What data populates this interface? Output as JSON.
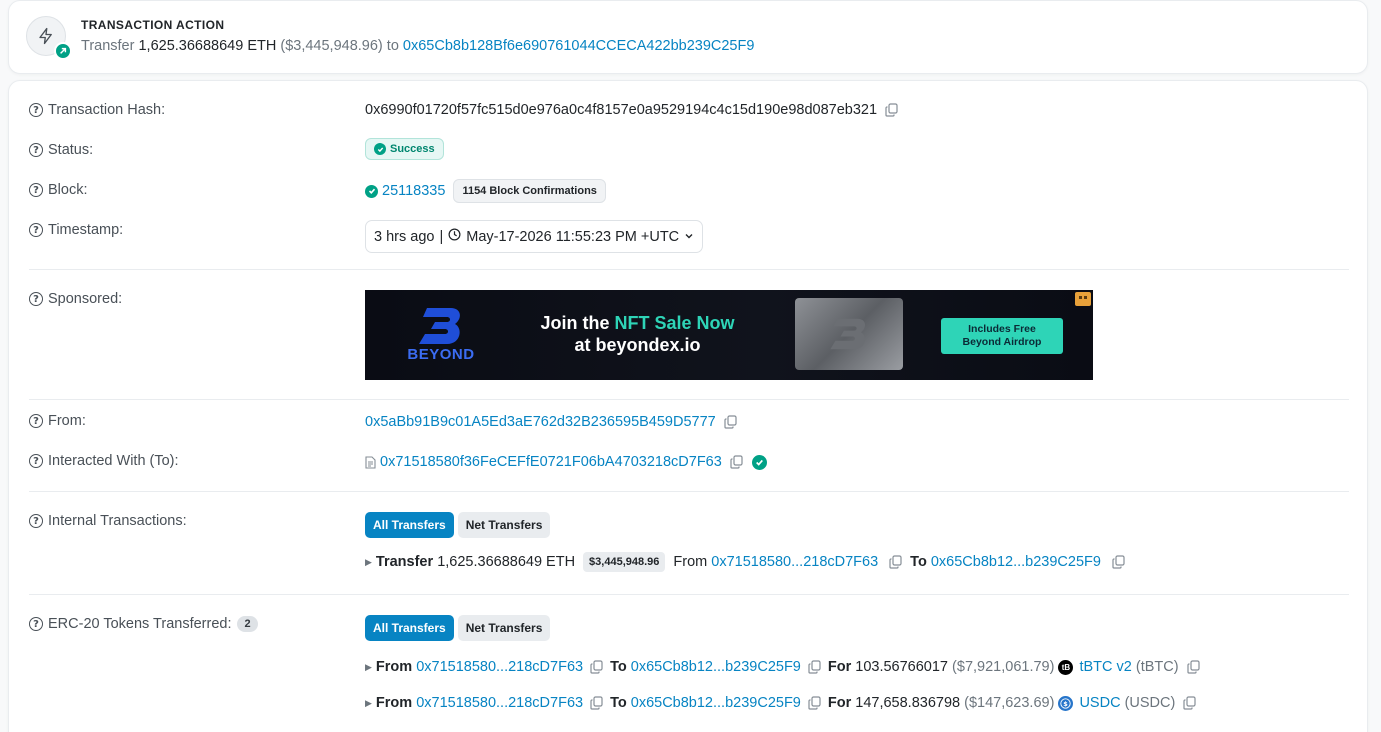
{
  "action": {
    "title": "TRANSACTION ACTION",
    "verb": "Transfer",
    "amount": "1,625.36688649 ETH",
    "usd": "($3,445,948.96)",
    "to_word": "to",
    "to_address": "0x65Cb8b128Bf6e690761044CCECA422bb239C25F9"
  },
  "details": {
    "tx_hash": {
      "label": "Transaction Hash:",
      "value": "0x6990f01720f57fc515d0e976a0c4f8157e0a9529194c4c15d190e98d087eb321"
    },
    "status": {
      "label": "Status:",
      "value": "Success"
    },
    "block": {
      "label": "Block:",
      "number": "25118335",
      "confirmations": "1154 Block Confirmations"
    },
    "timestamp": {
      "label": "Timestamp:",
      "ago": "3 hrs ago",
      "sep": "|",
      "datetime": "May-17-2026 11:55:23 PM +UTC"
    },
    "sponsored": {
      "label": "Sponsored:",
      "brand": "BEYOND",
      "headline_pre": "Join the ",
      "headline_hl": "NFT Sale Now",
      "headline_post": "at beyondex.io",
      "cta": "Includes Free Beyond Airdrop"
    },
    "from": {
      "label": "From:",
      "value": "0x5aBb91B9c01A5Ed3aE762d32B236595B459D5777"
    },
    "interacted": {
      "label": "Interacted With (To):",
      "value": "0x71518580f36FeCEFfE0721F06bA4703218cD7F63"
    },
    "internal": {
      "label": "Internal Transactions:",
      "btn_all": "All Transfers",
      "btn_net": "Net Transfers",
      "row": {
        "verb": "Transfer",
        "amount": "1,625.36688649 ETH",
        "usd": "$3,445,948.96",
        "from_word": "From",
        "from_addr": "0x71518580...218cD7F63",
        "to_word": "To",
        "to_addr": "0x65Cb8b12...b239C25F9"
      }
    },
    "erc20": {
      "label": "ERC-20 Tokens Transferred:",
      "count": "2",
      "btn_all": "All Transfers",
      "btn_net": "Net Transfers",
      "rows": [
        {
          "from_word": "From",
          "from_addr": "0x71518580...218cD7F63",
          "to_word": "To",
          "to_addr": "0x65Cb8b12...b239C25F9",
          "for_word": "For",
          "amount": "103.56766017",
          "usd": "($7,921,061.79)",
          "token_name": "tBTC v2",
          "token_symbol": "(tBTC)",
          "token_icon": "tbtc-icon",
          "token_color": "#000000"
        },
        {
          "from_word": "From",
          "from_addr": "0x71518580...218cD7F63",
          "to_word": "To",
          "to_addr": "0x65Cb8b12...b239C25F9",
          "for_word": "For",
          "amount": "147,658.836798",
          "usd": "($147,623.69)",
          "token_name": "USDC",
          "token_symbol": "(USDC)",
          "token_icon": "usdc-icon",
          "token_color": "#2775ca"
        }
      ]
    }
  },
  "colors": {
    "link": "#0784c3",
    "success": "#00a186",
    "accent_teal": "#2ed4b7"
  }
}
